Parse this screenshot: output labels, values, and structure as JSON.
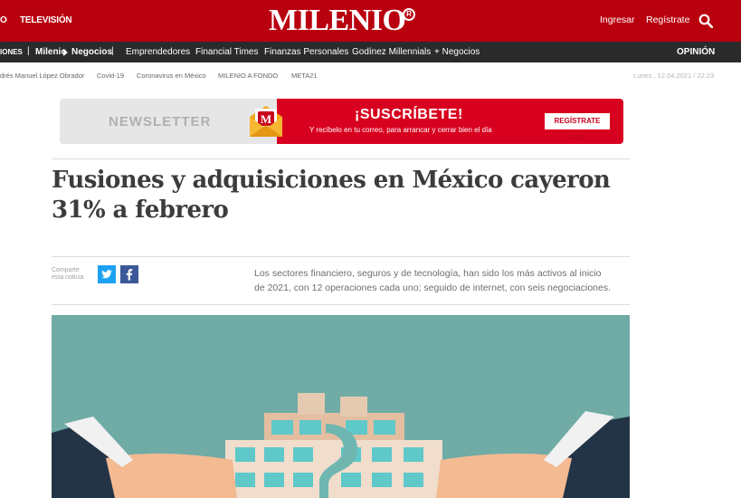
{
  "topbar": {
    "left_links": [
      "O",
      "TELEVISIÓN"
    ],
    "logo": "MILENIO",
    "logo_mark": "R",
    "ingresar": "Ingresar",
    "registrate": "Regístrate",
    "search_icon": "search-icon"
  },
  "navbar": {
    "first_fragment": "IONES",
    "milenio_negocios_a": "Milenio",
    "milenio_negocios_b": "Negocios",
    "items": [
      "Emprendedores",
      "Financial Times",
      "Finanzas Personales",
      "Godínez Millennials",
      "+ Negocios"
    ],
    "opinion": "OPINIÓN"
  },
  "subnav": {
    "items": [
      "drés Manuel López Obrador",
      "Covid-19",
      "Coronavirus en México",
      "MILENIO A FONDO",
      "META21"
    ],
    "date": "Lunes , 12.04.2021 / 22:23"
  },
  "banner": {
    "newsletter": "NEWSLETTER",
    "subscribe": "¡SUSCRÍBETE!",
    "subtitle": "Y recíbelo en tu correo, para arrancar y cerrar bien el día",
    "cta": "REGÍSTRATE AQUÍ",
    "envelope_letter": "M"
  },
  "article": {
    "headline_line1": "Fusiones y adquisiciones en México cayeron",
    "headline_line2": "31% a febrero",
    "share_label_1": "Comparte",
    "share_label_2": "esta noticia",
    "summary_line1": "Los sectores financiero, seguros y de tecnología, han sido los más activos al inicio",
    "summary_line2": "de 2021, con 12 operaciones cada uno; seguido de internet, con seis negociaciones."
  },
  "colors": {
    "brand_red": "#b9000f",
    "nav_dark": "#2a2a2a",
    "banner_red": "#d8001f",
    "twitter": "#1da1f2",
    "facebook": "#3b5998",
    "illustration_bg": "#70aba6"
  }
}
